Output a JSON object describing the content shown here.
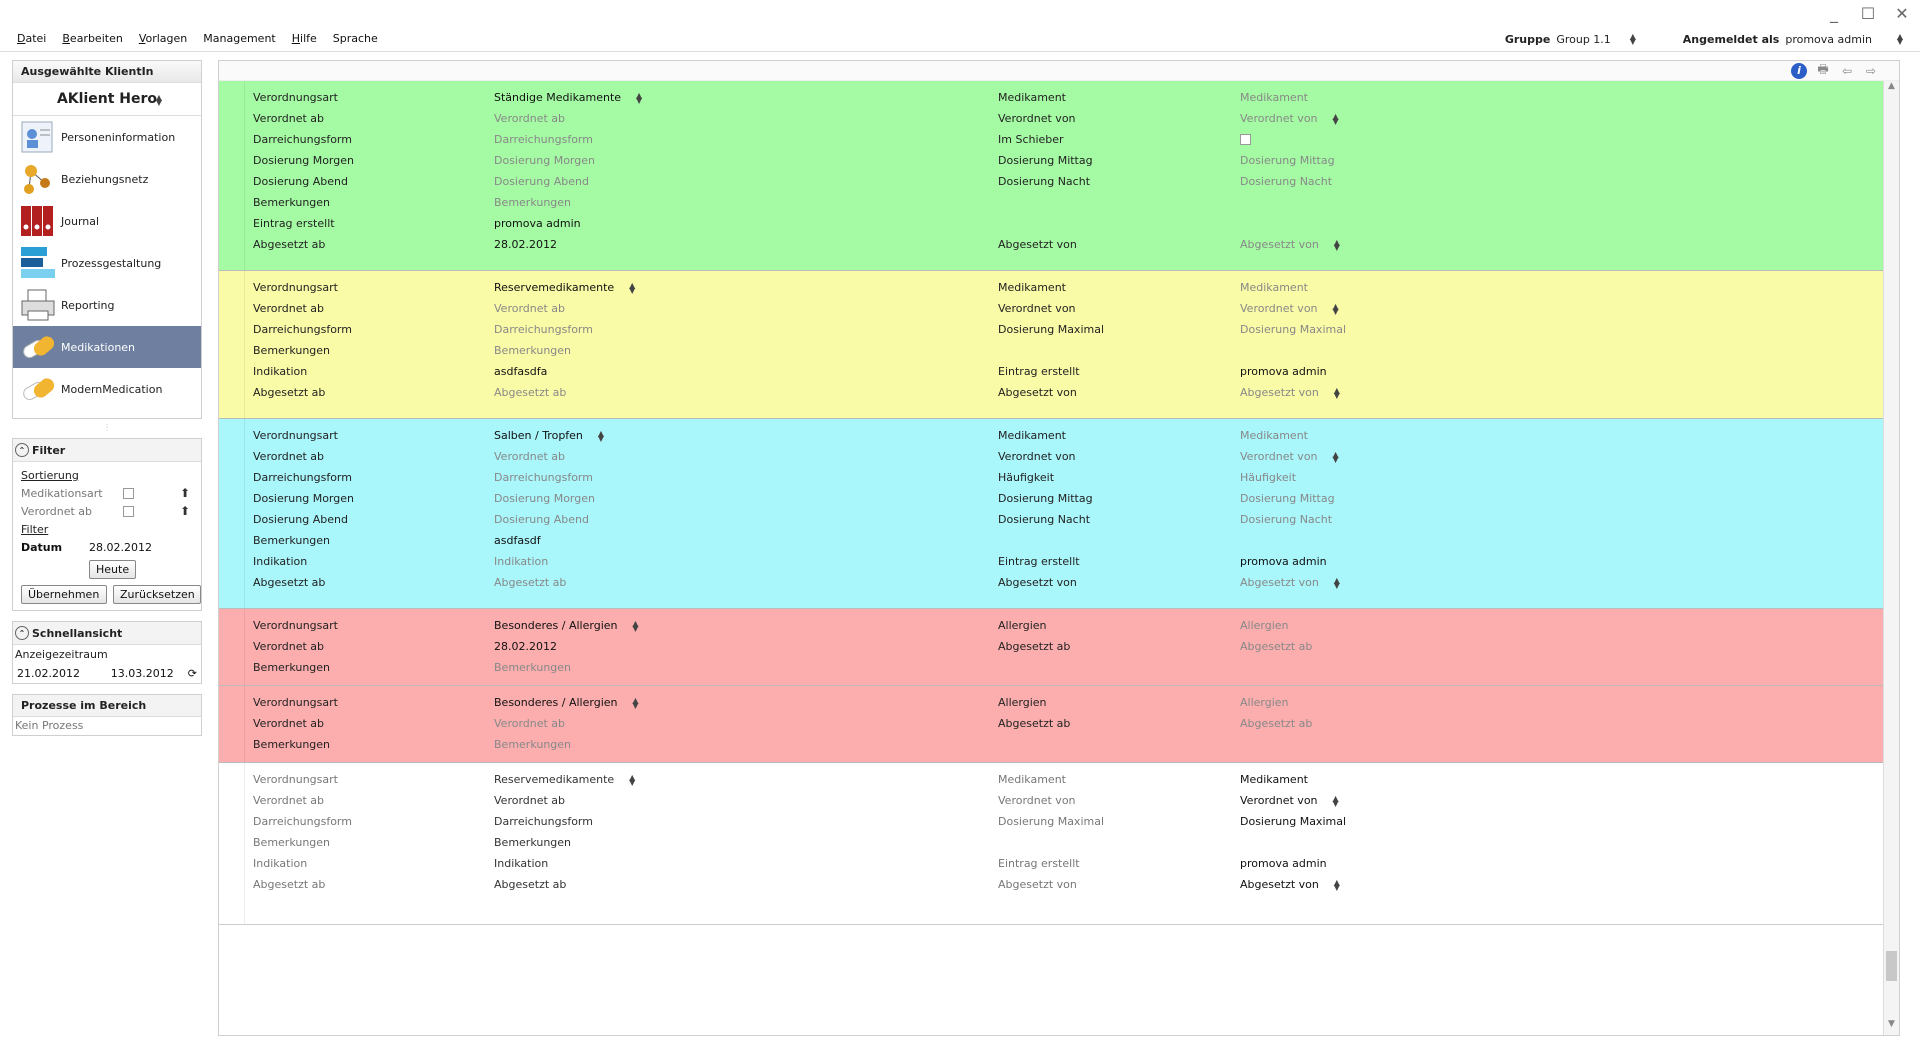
{
  "menu": {
    "items": [
      "Datei",
      "Bearbeiten",
      "Vorlagen",
      "Management",
      "Hilfe",
      "Sprache"
    ],
    "gruppe_label": "Gruppe",
    "gruppe_value": "Group 1.1",
    "angemeldet_label": "Angemeldet als",
    "angemeldet_value": "promova admin"
  },
  "sidebar": {
    "client_header": "Ausgewählte KlientIn",
    "client_name": "AKlient Hero",
    "nav": [
      {
        "label": "Personeninformation",
        "icon": "person-card-icon"
      },
      {
        "label": "Beziehungsnetz",
        "icon": "network-icon"
      },
      {
        "label": "Journal",
        "icon": "binders-icon"
      },
      {
        "label": "Prozessgestaltung",
        "icon": "process-bars-icon"
      },
      {
        "label": "Reporting",
        "icon": "printer-icon"
      },
      {
        "label": "Medikationen",
        "icon": "pills-icon"
      },
      {
        "label": "ModernMedication",
        "icon": "pills-icon"
      }
    ],
    "filter": {
      "title": "Filter",
      "sortierung": "Sortierung",
      "medikationsart": "Medikationsart",
      "verordnet_ab": "Verordnet ab",
      "filter_link": "Filter",
      "datum_label": "Datum",
      "datum_value": "28.02.2012",
      "heute": "Heute",
      "uebernehmen": "Übernehmen",
      "zuruecksetzen": "Zurücksetzen"
    },
    "schnellansicht": {
      "title": "Schnellansicht",
      "anzeigezeitraum": "Anzeigezeitraum",
      "from": "21.02.2012",
      "to": "13.03.2012"
    },
    "prozesse": {
      "title": "Prozesse im Bereich",
      "empty": "Kein Prozess"
    }
  },
  "records": [
    {
      "color": "green",
      "rows": [
        {
          "l1": "Verordnungsart",
          "v1": "Ständige Medikamente",
          "s1": true,
          "l2": "Medikament",
          "v2": "Medikament",
          "p2": true
        },
        {
          "l1": "Verordnet ab",
          "v1": "Verordnet ab",
          "p1": true,
          "l2": "Verordnet von",
          "v2": "Verordnet von",
          "p2": true,
          "s2": true
        },
        {
          "l1": "Darreichungsform",
          "v1": "Darreichungsform",
          "p1": true,
          "l2": "Im Schieber",
          "chk": true
        },
        {
          "l1": "Dosierung Morgen",
          "v1": "Dosierung Morgen",
          "p1": true,
          "l2": "Dosierung Mittag",
          "v2": "Dosierung Mittag",
          "p2": true
        },
        {
          "l1": "Dosierung Abend",
          "v1": "Dosierung Abend",
          "p1": true,
          "l2": "Dosierung Nacht",
          "v2": "Dosierung Nacht",
          "p2": true
        },
        {
          "l1": "Bemerkungen",
          "v1": "Bemerkungen",
          "p1": true
        },
        {
          "l1": "Eintrag erstellt",
          "v1": "promova admin"
        },
        {
          "l1": "Abgesetzt ab",
          "v1": "28.02.2012",
          "l2": "Abgesetzt von",
          "v2": "Abgesetzt von",
          "p2": true,
          "s2": true
        }
      ]
    },
    {
      "color": "yellow",
      "rows": [
        {
          "l1": "Verordnungsart",
          "v1": "Reservemedikamente",
          "s1": true,
          "l2": "Medikament",
          "v2": "Medikament",
          "p2": true
        },
        {
          "l1": "Verordnet ab",
          "v1": "Verordnet ab",
          "p1": true,
          "l2": "Verordnet von",
          "v2": "Verordnet von",
          "p2": true,
          "s2": true
        },
        {
          "l1": "Darreichungsform",
          "v1": "Darreichungsform",
          "p1": true,
          "l2": "Dosierung Maximal",
          "v2": "Dosierung Maximal",
          "p2": true
        },
        {
          "l1": "Bemerkungen",
          "v1": "Bemerkungen",
          "p1": true
        },
        {
          "l1": "Indikation",
          "v1": "asdfasdfa",
          "l2": "Eintrag erstellt",
          "v2": "promova admin"
        },
        {
          "l1": "Abgesetzt ab",
          "v1": "Abgesetzt ab",
          "p1": true,
          "l2": "Abgesetzt von",
          "v2": "Abgesetzt von",
          "p2": true,
          "s2": true
        }
      ]
    },
    {
      "color": "cyan",
      "rows": [
        {
          "l1": "Verordnungsart",
          "v1": "Salben / Tropfen",
          "s1": true,
          "l2": "Medikament",
          "v2": "Medikament",
          "p2": true
        },
        {
          "l1": "Verordnet ab",
          "v1": "Verordnet ab",
          "p1": true,
          "l2": "Verordnet von",
          "v2": "Verordnet von",
          "p2": true,
          "s2": true
        },
        {
          "l1": "Darreichungsform",
          "v1": "Darreichungsform",
          "p1": true,
          "l2": "Häufigkeit",
          "v2": "Häufigkeit",
          "p2": true
        },
        {
          "l1": "Dosierung Morgen",
          "v1": "Dosierung Morgen",
          "p1": true,
          "l2": "Dosierung Mittag",
          "v2": "Dosierung Mittag",
          "p2": true
        },
        {
          "l1": "Dosierung Abend",
          "v1": "Dosierung Abend",
          "p1": true,
          "l2": "Dosierung Nacht",
          "v2": "Dosierung Nacht",
          "p2": true
        },
        {
          "l1": "Bemerkungen",
          "v1": "asdfasdf"
        },
        {
          "l1": "Indikation",
          "v1": "Indikation",
          "p1": true,
          "l2": "Eintrag erstellt",
          "v2": "promova admin"
        },
        {
          "l1": "Abgesetzt ab",
          "v1": "Abgesetzt ab",
          "p1": true,
          "l2": "Abgesetzt von",
          "v2": "Abgesetzt von",
          "p2": true,
          "s2": true
        }
      ]
    },
    {
      "color": "red",
      "rows": [
        {
          "l1": "Verordnungsart",
          "v1": "Besonderes / Allergien",
          "s1": true,
          "l2": "Allergien",
          "v2": "Allergien",
          "p2": true
        },
        {
          "l1": "Verordnet ab",
          "v1": "28.02.2012",
          "l2": "Abgesetzt ab",
          "v2": "Abgesetzt ab",
          "p2": true
        },
        {
          "l1": "Bemerkungen",
          "v1": "Bemerkungen",
          "p1": true
        }
      ]
    },
    {
      "color": "red",
      "rows": [
        {
          "l1": "Verordnungsart",
          "v1": "Besonderes / Allergien",
          "s1": true,
          "l2": "Allergien",
          "v2": "Allergien",
          "p2": true
        },
        {
          "l1": "Verordnet ab",
          "v1": "Verordnet ab",
          "p1": true,
          "l2": "Abgesetzt ab",
          "v2": "Abgesetzt ab",
          "p2": true
        },
        {
          "l1": "Bemerkungen",
          "v1": "Bemerkungen",
          "p1": true
        }
      ]
    },
    {
      "color": "white",
      "rows": [
        {
          "l1": "Verordnungsart",
          "v1": "Reservemedikamente",
          "s1": true,
          "l2": "Medikament",
          "v2": "Medikament"
        },
        {
          "l1": "Verordnet ab",
          "v1": "Verordnet ab",
          "l2": "Verordnet von",
          "v2": "Verordnet von",
          "s2": true
        },
        {
          "l1": "Darreichungsform",
          "v1": "Darreichungsform",
          "l2": "Dosierung Maximal",
          "v2": "Dosierung Maximal"
        },
        {
          "l1": "Bemerkungen",
          "v1": "Bemerkungen"
        },
        {
          "l1": "Indikation",
          "v1": "Indikation",
          "l2": "Eintrag erstellt",
          "v2": "promova admin"
        },
        {
          "l1": "Abgesetzt ab",
          "v1": "Abgesetzt ab",
          "l2": "Abgesetzt von",
          "v2": "Abgesetzt von",
          "s2": true
        }
      ]
    }
  ]
}
